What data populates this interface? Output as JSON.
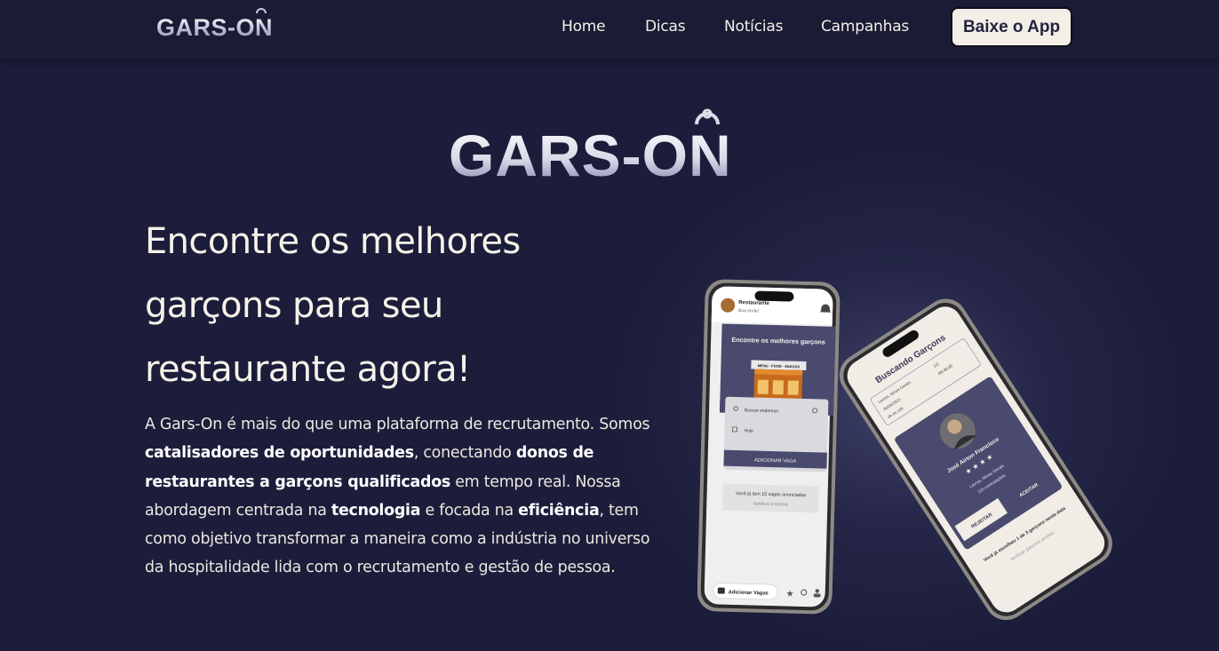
{
  "nav": {
    "logo_text": "GARS-ON",
    "links": [
      "Home",
      "Dicas",
      "Notícias",
      "Campanhas"
    ],
    "download_label": "Baixe o App"
  },
  "hero": {
    "logo_text": "GARS-ON",
    "headline_lines": [
      "Encontre os melhores",
      "garçons para seu",
      "restaurante agora!"
    ],
    "description": [
      {
        "text": "A Gars-On é mais do que uma plataforma de recrutamento. Somos ",
        "bold": false
      },
      {
        "text": "catalisadores de oportunidades",
        "bold": true
      },
      {
        "text": ", conectando ",
        "bold": false
      },
      {
        "text": "donos de restaurantes a garçons qualificados",
        "bold": true
      },
      {
        "text": " em tempo real. Nossa abordagem centrada na ",
        "bold": false
      },
      {
        "text": "tecnologia",
        "bold": true
      },
      {
        "text": " e focada na ",
        "bold": false
      },
      {
        "text": "eficiência",
        "bold": true
      },
      {
        "text": ", tem como objetivo transformar a maneira como a indústria no universo da hospitalidade lida com o recrutamento e gestão de pessoa.",
        "bold": false
      }
    ]
  },
  "phone_left": {
    "header_title": "Restaurante",
    "header_subtitle": "Boa tarde!",
    "banner_text": "Encontre os melhores garçons",
    "store_sign": "MENU · FOOD · SNACKS",
    "search_address": "Buscar endereço",
    "date_field": "Hoje",
    "add_button": "ADICIONAR VAGA",
    "vacancies_text": "Você já tem 15 vagas anunciadas",
    "check_link": "Verificar inscritos",
    "bottom_button": "Adicionar Vagas"
  },
  "phone_right": {
    "title": "Buscando Garçons",
    "info_location": "Lavras, Minas Gerais",
    "info_date": "26/08/2023",
    "info_time": "8h às 16h",
    "info_people": "1/3",
    "info_price": "R$ 80,00",
    "waiter_name": "José Airton Francisco",
    "waiter_location": "Lavras, Minas Gerais",
    "waiter_count": "116 contratações",
    "reject_label": "REJEITAR",
    "accept_label": "ACEITAR",
    "footer_text": "Você já escolheu 1 de 3 garçons nesta data",
    "footer_link": "Verificar garçons aceitos"
  },
  "colors": {
    "background": "#1c1d3a",
    "navbar": "#1a1b35",
    "button_bg": "#f3eee6",
    "button_text": "#22233f",
    "app_purple": "#4a4a6e"
  }
}
